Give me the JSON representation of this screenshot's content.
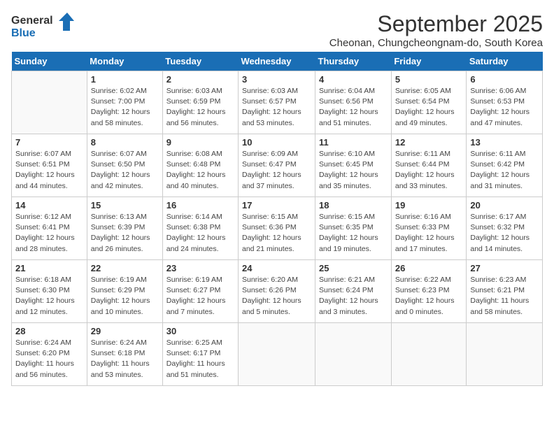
{
  "logo": {
    "line1": "General",
    "line2": "Blue"
  },
  "title": "September 2025",
  "subtitle": "Cheonan, Chungcheongnam-do, South Korea",
  "days_of_week": [
    "Sunday",
    "Monday",
    "Tuesday",
    "Wednesday",
    "Thursday",
    "Friday",
    "Saturday"
  ],
  "weeks": [
    [
      {
        "day": "",
        "info": ""
      },
      {
        "day": "1",
        "info": "Sunrise: 6:02 AM\nSunset: 7:00 PM\nDaylight: 12 hours\nand 58 minutes."
      },
      {
        "day": "2",
        "info": "Sunrise: 6:03 AM\nSunset: 6:59 PM\nDaylight: 12 hours\nand 56 minutes."
      },
      {
        "day": "3",
        "info": "Sunrise: 6:03 AM\nSunset: 6:57 PM\nDaylight: 12 hours\nand 53 minutes."
      },
      {
        "day": "4",
        "info": "Sunrise: 6:04 AM\nSunset: 6:56 PM\nDaylight: 12 hours\nand 51 minutes."
      },
      {
        "day": "5",
        "info": "Sunrise: 6:05 AM\nSunset: 6:54 PM\nDaylight: 12 hours\nand 49 minutes."
      },
      {
        "day": "6",
        "info": "Sunrise: 6:06 AM\nSunset: 6:53 PM\nDaylight: 12 hours\nand 47 minutes."
      }
    ],
    [
      {
        "day": "7",
        "info": "Sunrise: 6:07 AM\nSunset: 6:51 PM\nDaylight: 12 hours\nand 44 minutes."
      },
      {
        "day": "8",
        "info": "Sunrise: 6:07 AM\nSunset: 6:50 PM\nDaylight: 12 hours\nand 42 minutes."
      },
      {
        "day": "9",
        "info": "Sunrise: 6:08 AM\nSunset: 6:48 PM\nDaylight: 12 hours\nand 40 minutes."
      },
      {
        "day": "10",
        "info": "Sunrise: 6:09 AM\nSunset: 6:47 PM\nDaylight: 12 hours\nand 37 minutes."
      },
      {
        "day": "11",
        "info": "Sunrise: 6:10 AM\nSunset: 6:45 PM\nDaylight: 12 hours\nand 35 minutes."
      },
      {
        "day": "12",
        "info": "Sunrise: 6:11 AM\nSunset: 6:44 PM\nDaylight: 12 hours\nand 33 minutes."
      },
      {
        "day": "13",
        "info": "Sunrise: 6:11 AM\nSunset: 6:42 PM\nDaylight: 12 hours\nand 31 minutes."
      }
    ],
    [
      {
        "day": "14",
        "info": "Sunrise: 6:12 AM\nSunset: 6:41 PM\nDaylight: 12 hours\nand 28 minutes."
      },
      {
        "day": "15",
        "info": "Sunrise: 6:13 AM\nSunset: 6:39 PM\nDaylight: 12 hours\nand 26 minutes."
      },
      {
        "day": "16",
        "info": "Sunrise: 6:14 AM\nSunset: 6:38 PM\nDaylight: 12 hours\nand 24 minutes."
      },
      {
        "day": "17",
        "info": "Sunrise: 6:15 AM\nSunset: 6:36 PM\nDaylight: 12 hours\nand 21 minutes."
      },
      {
        "day": "18",
        "info": "Sunrise: 6:15 AM\nSunset: 6:35 PM\nDaylight: 12 hours\nand 19 minutes."
      },
      {
        "day": "19",
        "info": "Sunrise: 6:16 AM\nSunset: 6:33 PM\nDaylight: 12 hours\nand 17 minutes."
      },
      {
        "day": "20",
        "info": "Sunrise: 6:17 AM\nSunset: 6:32 PM\nDaylight: 12 hours\nand 14 minutes."
      }
    ],
    [
      {
        "day": "21",
        "info": "Sunrise: 6:18 AM\nSunset: 6:30 PM\nDaylight: 12 hours\nand 12 minutes."
      },
      {
        "day": "22",
        "info": "Sunrise: 6:19 AM\nSunset: 6:29 PM\nDaylight: 12 hours\nand 10 minutes."
      },
      {
        "day": "23",
        "info": "Sunrise: 6:19 AM\nSunset: 6:27 PM\nDaylight: 12 hours\nand 7 minutes."
      },
      {
        "day": "24",
        "info": "Sunrise: 6:20 AM\nSunset: 6:26 PM\nDaylight: 12 hours\nand 5 minutes."
      },
      {
        "day": "25",
        "info": "Sunrise: 6:21 AM\nSunset: 6:24 PM\nDaylight: 12 hours\nand 3 minutes."
      },
      {
        "day": "26",
        "info": "Sunrise: 6:22 AM\nSunset: 6:23 PM\nDaylight: 12 hours\nand 0 minutes."
      },
      {
        "day": "27",
        "info": "Sunrise: 6:23 AM\nSunset: 6:21 PM\nDaylight: 11 hours\nand 58 minutes."
      }
    ],
    [
      {
        "day": "28",
        "info": "Sunrise: 6:24 AM\nSunset: 6:20 PM\nDaylight: 11 hours\nand 56 minutes."
      },
      {
        "day": "29",
        "info": "Sunrise: 6:24 AM\nSunset: 6:18 PM\nDaylight: 11 hours\nand 53 minutes."
      },
      {
        "day": "30",
        "info": "Sunrise: 6:25 AM\nSunset: 6:17 PM\nDaylight: 11 hours\nand 51 minutes."
      },
      {
        "day": "",
        "info": ""
      },
      {
        "day": "",
        "info": ""
      },
      {
        "day": "",
        "info": ""
      },
      {
        "day": "",
        "info": ""
      }
    ]
  ]
}
